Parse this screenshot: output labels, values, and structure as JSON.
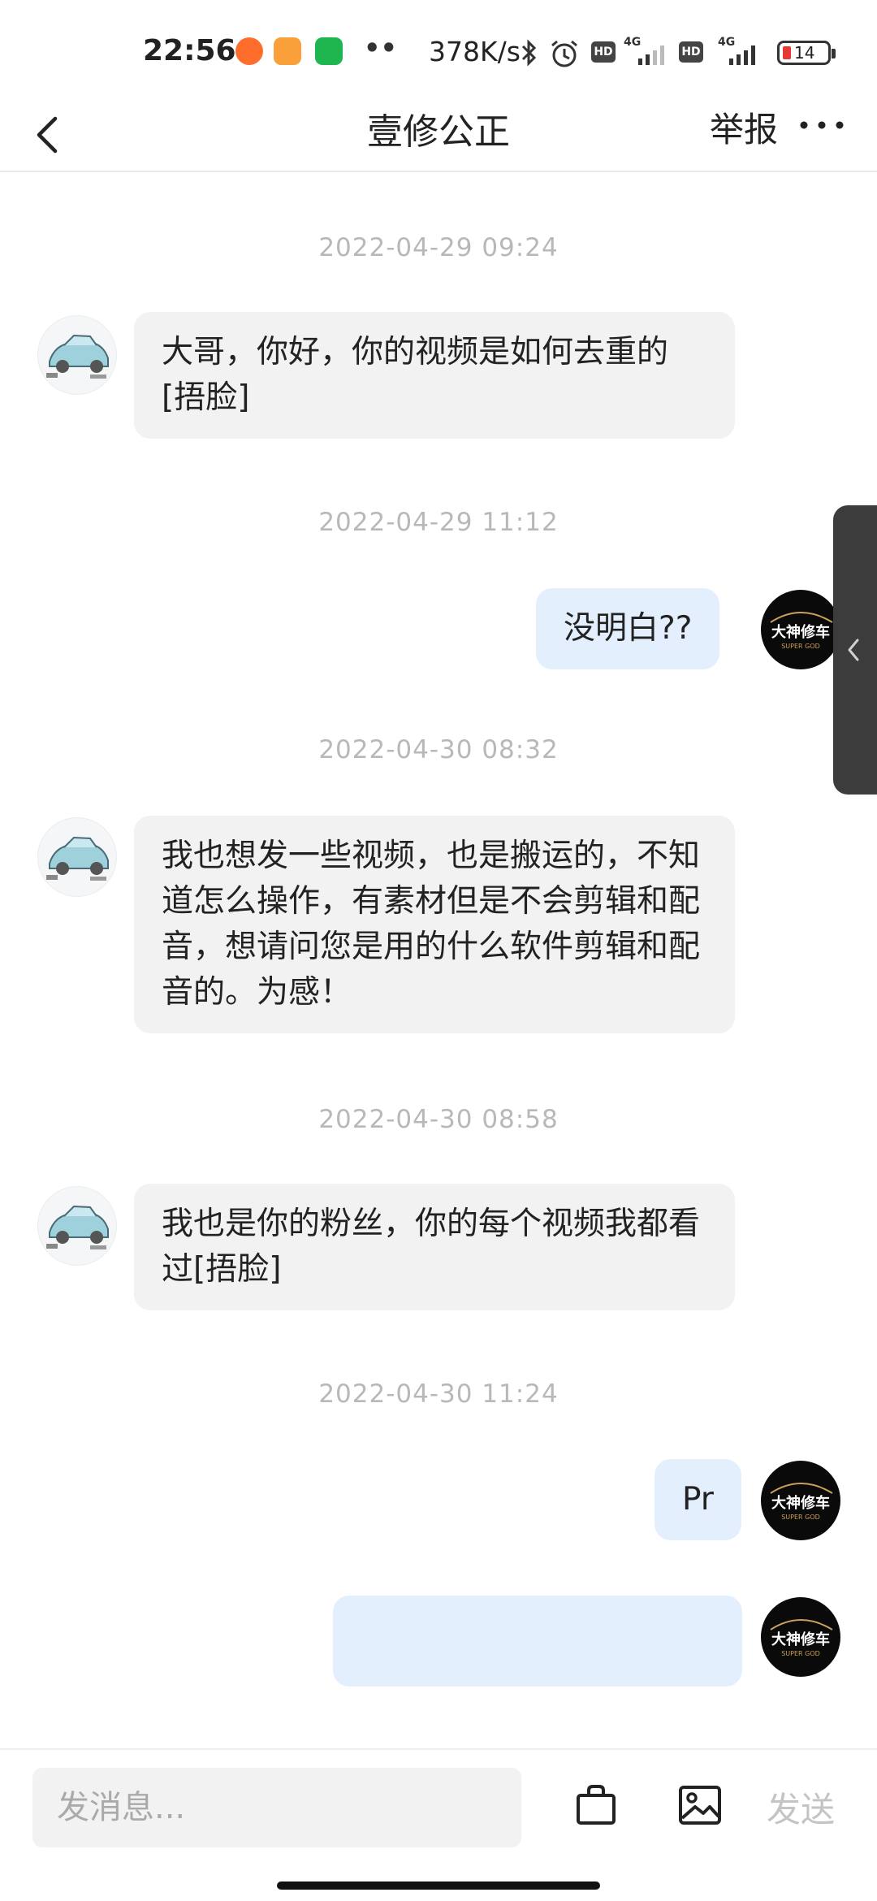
{
  "status_bar": {
    "time": "22:56",
    "more_dots": "••",
    "net_speed": "378K/s",
    "hd_1": "HD",
    "net_1": "4G",
    "hd_2": "HD",
    "net_2": "4G",
    "battery": "14",
    "app_colors": [
      "#ff6d2d",
      "#f9a03b",
      "#1fb64f"
    ]
  },
  "nav": {
    "title": "壹修公正",
    "report": "举报"
  },
  "messages": [
    {
      "timestamp": "2022-04-29 09:24",
      "text": "大哥，你好，你的视频是如何去重的[捂脸]"
    },
    {
      "timestamp": "2022-04-29 11:12",
      "text": "没明白??"
    },
    {
      "timestamp": "2022-04-30 08:32",
      "text": "我也想发一些视频，也是搬运的，不知道怎么操作，有素材但是不会剪辑和配音，想请问您是用的什么软件剪辑和配音的。为感！"
    },
    {
      "timestamp": "2022-04-30 08:58",
      "text": "我也是你的粉丝，你的每个视频我都看过[捂脸]"
    },
    {
      "timestamp": "2022-04-30 11:24",
      "text": "Pr"
    }
  ],
  "self_avatar": {
    "line1": "大神修车",
    "line2": "SUPER GOD"
  },
  "input": {
    "placeholder": "发消息...",
    "send": "发送"
  },
  "colors": {
    "bubble_incoming": "#f2f2f2",
    "bubble_outgoing": "#e3effd",
    "timestamp": "#b8b8b8",
    "send_disabled": "#c4c4c4"
  }
}
